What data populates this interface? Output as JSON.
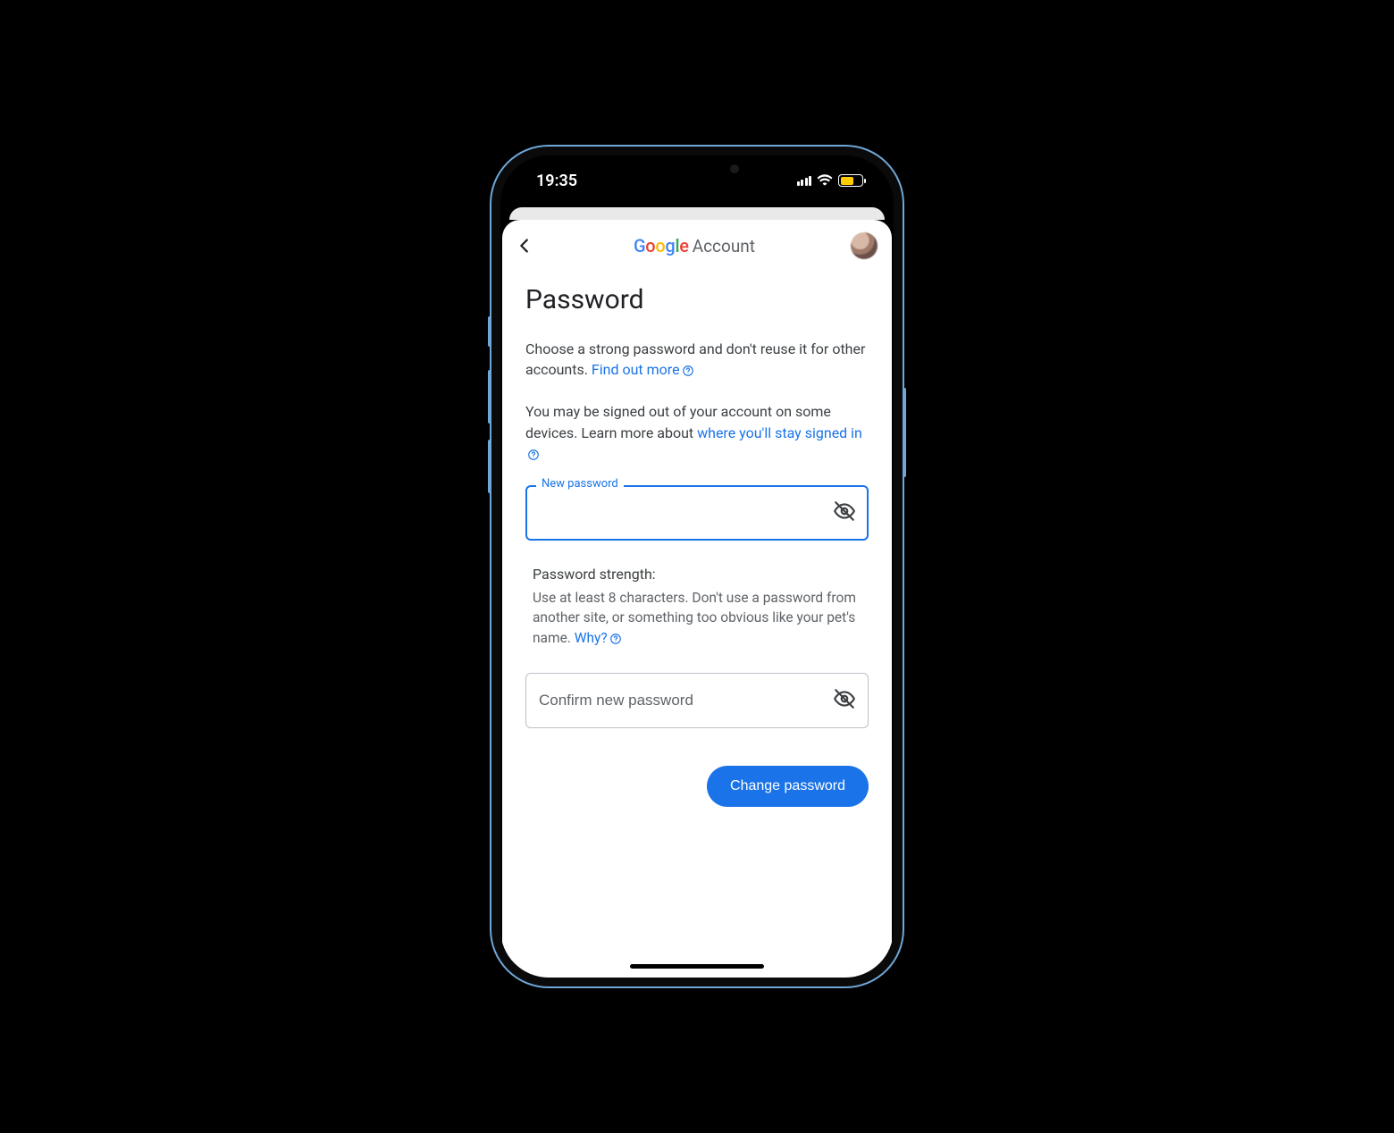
{
  "status": {
    "time": "19:35"
  },
  "header": {
    "logo_word": "Google",
    "account_word": "Account"
  },
  "page": {
    "title": "Password",
    "para1_a": "Choose a strong password and don't reuse it for other accounts. ",
    "link1": "Find out more",
    "para2_a": "You may be signed out of your account on some devices. Learn more about ",
    "link2": "where you'll stay signed in"
  },
  "fields": {
    "new_label": "New password",
    "confirm_placeholder": "Confirm new password"
  },
  "strength": {
    "title": "Password strength:",
    "text": "Use at least 8 characters. Don't use a password from another site, or something too obvious like your pet's name. ",
    "why_link": "Why?"
  },
  "actions": {
    "submit": "Change password"
  }
}
